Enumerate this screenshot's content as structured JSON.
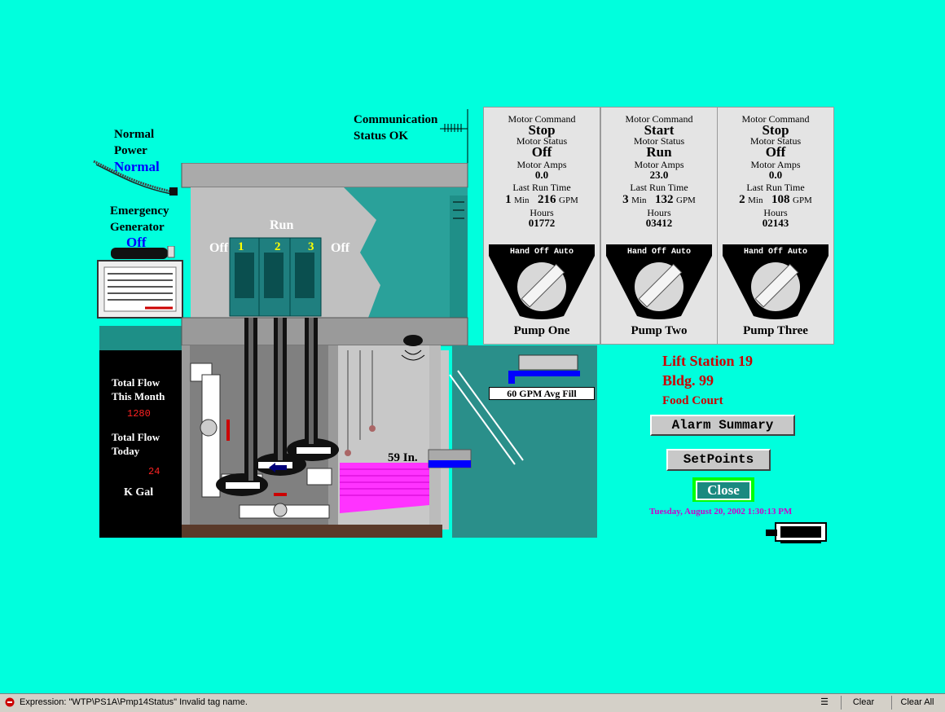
{
  "colors": {
    "background": "#00ffdd",
    "alarm_red": "#cc0000",
    "date_magenta": "#cc00cc",
    "status_blue": "#0000ff",
    "water_magenta": "#ff33ff"
  },
  "power": {
    "normal_label_1": "Normal",
    "normal_label_2": "Power",
    "normal_status": "Normal"
  },
  "generator": {
    "label_1": "Emergency",
    "label_2": "Generator",
    "status": "Off"
  },
  "communication": {
    "label": "Communication",
    "status": "Status OK"
  },
  "pump_states": {
    "run_label": "Run",
    "left": "Off",
    "right": "Off",
    "numbers": [
      "1",
      "2",
      "3"
    ]
  },
  "flow": {
    "month_label_1": "Total Flow",
    "month_label_2": "This Month",
    "month_value": "1280",
    "today_label_1": "Total Flow",
    "today_label_2": "Today",
    "today_value": "24",
    "units": "K Gal"
  },
  "wetwell": {
    "level": "59 In.",
    "level_inches": 59,
    "fill_rate": "60  GPM Avg Fill"
  },
  "pumps": [
    {
      "cmd_label": "Motor Command",
      "cmd": "Stop",
      "status_label": "Motor Status",
      "status": "Off",
      "amps_label": "Motor Amps",
      "amps": "0.0",
      "runtime_label": "Last Run Time",
      "run_min": "1",
      "min_unit": "Min",
      "gpm": "216",
      "gpm_unit": "GPM",
      "hours_label": "Hours",
      "hours": "01772",
      "hoa": [
        "Hand",
        "Off",
        "Auto"
      ],
      "name": "Pump One"
    },
    {
      "cmd_label": "Motor Command",
      "cmd": "Start",
      "status_label": "Motor Status",
      "status": "Run",
      "amps_label": "Motor Amps",
      "amps": "23.0",
      "runtime_label": "Last Run Time",
      "run_min": "3",
      "min_unit": "Min",
      "gpm": "132",
      "gpm_unit": "GPM",
      "hours_label": "Hours",
      "hours": "03412",
      "hoa": [
        "Hand",
        "Off",
        "Auto"
      ],
      "name": "Pump Two"
    },
    {
      "cmd_label": "Motor Command",
      "cmd": "Stop",
      "status_label": "Motor Status",
      "status": "Off",
      "amps_label": "Motor Amps",
      "amps": "0.0",
      "runtime_label": "Last Run Time",
      "run_min": "2",
      "min_unit": "Min",
      "gpm": "108",
      "gpm_unit": "GPM",
      "hours_label": "Hours",
      "hours": "02143",
      "hoa": [
        "Hand",
        "Off",
        "Auto"
      ],
      "name": "Pump Three"
    }
  ],
  "station": {
    "title": "Lift Station 19",
    "building": "Bldg. 99",
    "location": "Food Court"
  },
  "buttons": {
    "alarm_summary": "Alarm Summary",
    "setpoints": "SetPoints",
    "close": "Close"
  },
  "datetime": "Tuesday, August 20, 2002  1:30:13 PM",
  "statusbar": {
    "message": "Expression: \"WTP\\PS1A\\Pmp14Status\"  Invalid tag name.",
    "clear": "Clear",
    "clear_all": "Clear All"
  }
}
